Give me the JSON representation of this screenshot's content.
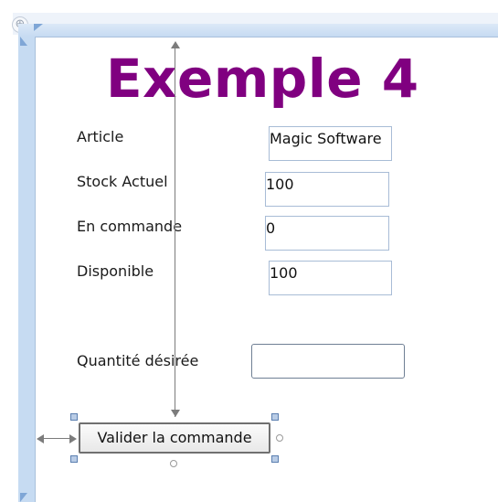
{
  "form": {
    "title": "Exemple 4",
    "title_color": "#800080",
    "fields": [
      {
        "label": "Article",
        "value": "Magic Software"
      },
      {
        "label": "Stock Actuel",
        "value": "100"
      },
      {
        "label": "En commande",
        "value": "0"
      },
      {
        "label": "Disponible",
        "value": "100"
      }
    ],
    "quantity": {
      "label": "Quantité désirée",
      "value": ""
    },
    "submit_label": "Valider la commande"
  },
  "designer": {
    "move_handle_icon": "move-icon",
    "accent_color": "#c6dbf2"
  }
}
